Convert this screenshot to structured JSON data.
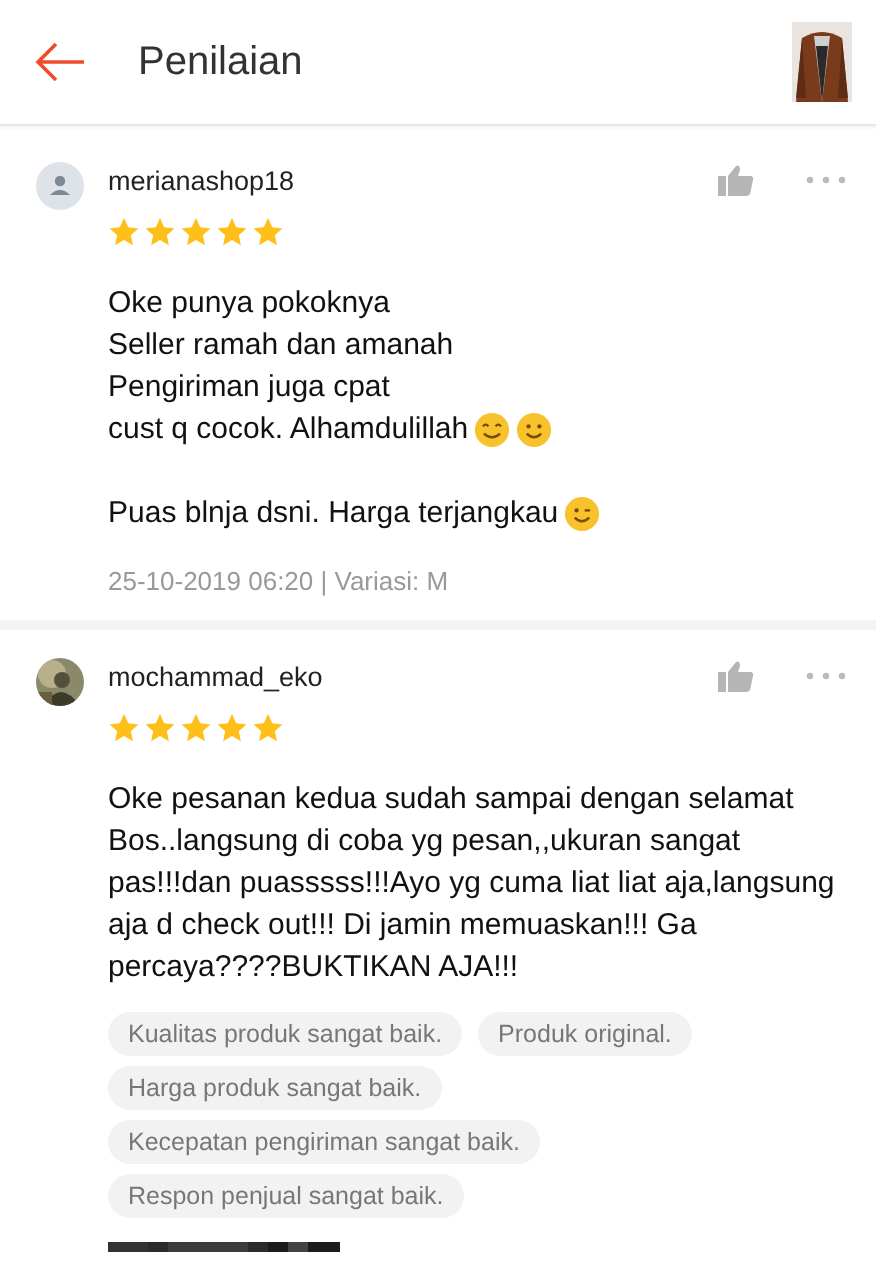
{
  "header": {
    "title": "Penilaian",
    "product_image": {
      "kind": "picture"
    }
  },
  "reviews": [
    {
      "username": "merianashop18",
      "avatar": {
        "kind": "default"
      },
      "stars": 5,
      "paragraphs": [
        {
          "lines": [
            {
              "text": "Oke punya pokoknya"
            },
            {
              "text": "Seller ramah dan amanah"
            },
            {
              "text": "Pengiriman juga cpat"
            },
            {
              "text": "cust q cocok. Alhamdulillah",
              "emojis": [
                {
                  "kind": "grin"
                },
                {
                  "kind": "smile"
                }
              ]
            }
          ]
        },
        {
          "lines": [
            {
              "text": "Puas blnja dsni. Harga terjangkau",
              "emojis": [
                {
                  "kind": "wink"
                }
              ]
            }
          ]
        }
      ],
      "meta": "25-10-2019 06:20 | Variasi: M"
    },
    {
      "username": "mochammad_eko",
      "avatar": {
        "kind": "picture"
      },
      "stars": 5,
      "paragraphs": [
        {
          "lines": [
            {
              "text": "Oke pesanan kedua sudah sampai dengan selamat Bos..langsung di coba yg pesan,,ukuran sangat pas!!!dan puasssss!!!Ayo yg cuma liat liat aja,langsung aja d check out!!! Di jamin memuaskan!!! Ga percaya????BUKTIKAN AJA!!!"
            }
          ]
        }
      ],
      "tags": [
        "Kualitas produk sangat baik.",
        "Produk original.",
        "Harga produk sangat baik.",
        "Kecepatan pengiriman sangat baik.",
        "Respon penjual sangat baik."
      ],
      "photos": [
        {
          "kind": "picture"
        }
      ]
    }
  ]
}
